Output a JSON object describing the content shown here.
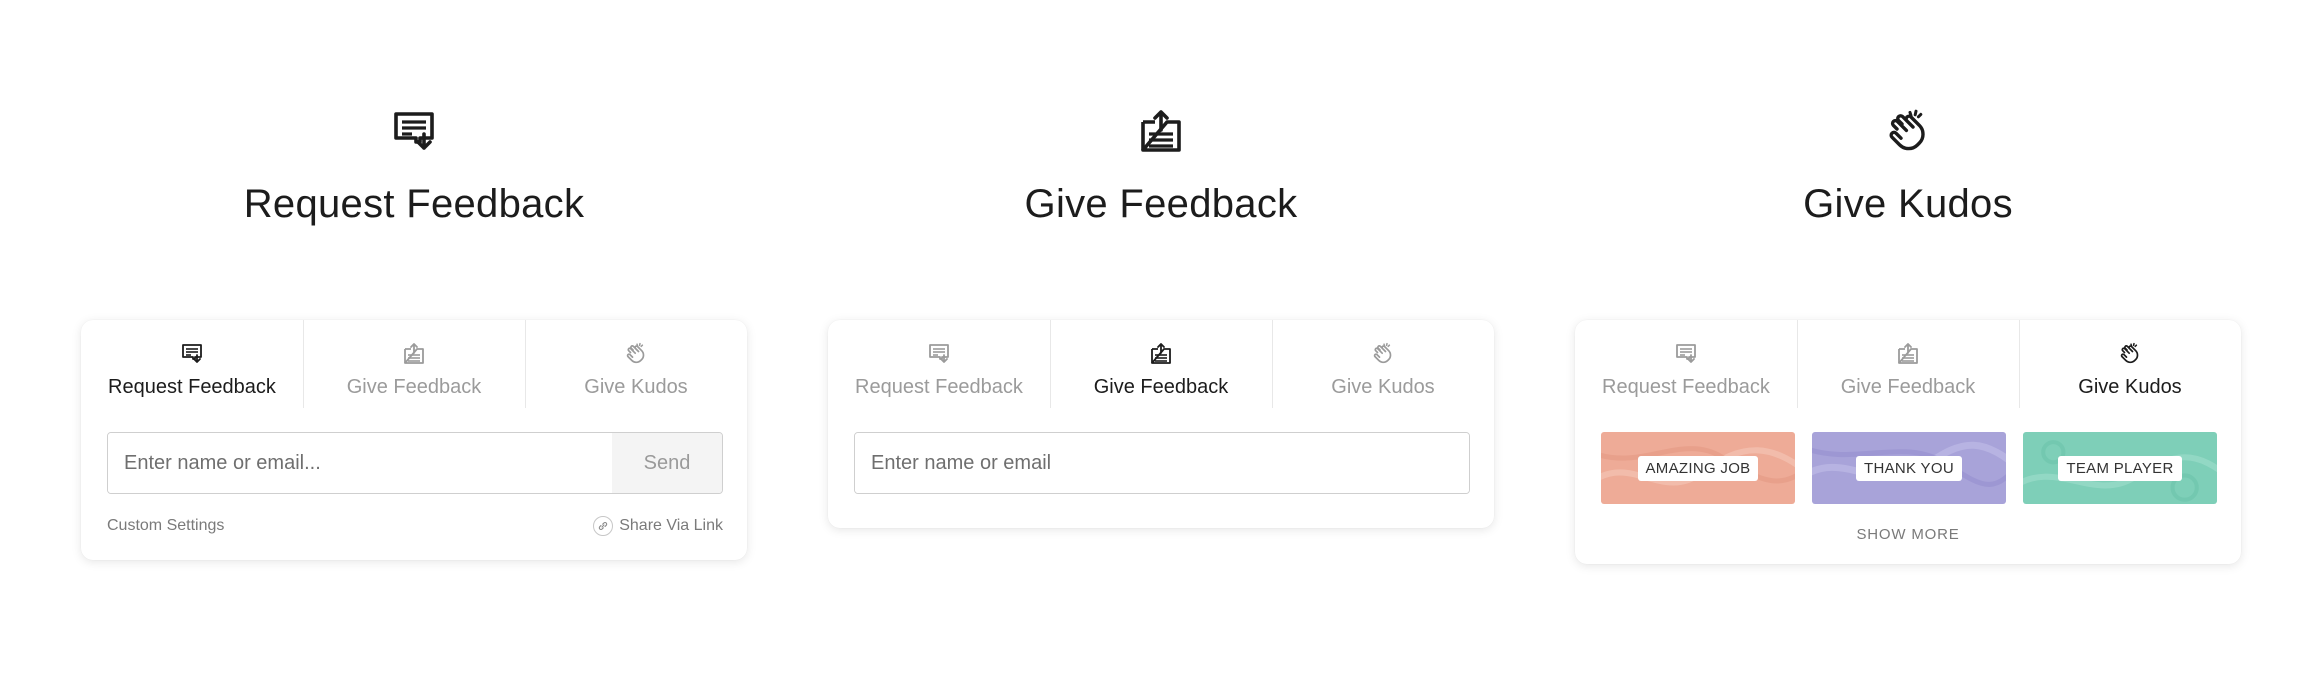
{
  "sections": [
    {
      "icon": "request-feedback-icon",
      "title": "Request Feedback",
      "active_tab": 0
    },
    {
      "icon": "give-feedback-icon",
      "title": "Give Feedback",
      "active_tab": 1
    },
    {
      "icon": "clapping-hands-icon",
      "title": "Give Kudos",
      "active_tab": 2
    }
  ],
  "tabs": [
    {
      "label": "Request Feedback",
      "icon": "request-feedback-icon"
    },
    {
      "label": "Give Feedback",
      "icon": "give-feedback-icon"
    },
    {
      "label": "Give Kudos",
      "icon": "clapping-hands-icon"
    }
  ],
  "request_card": {
    "placeholder": "Enter name or email...",
    "value": "",
    "send_label": "Send",
    "custom_settings_label": "Custom Settings",
    "share_link_label": "Share Via Link",
    "share_icon": "link-icon"
  },
  "give_card": {
    "placeholder": "Enter name or email",
    "value": ""
  },
  "kudos_card": {
    "cards": [
      {
        "label": "AMAZING JOB",
        "color": "#eeab97"
      },
      {
        "label": "THANK YOU",
        "color": "#a8a3d9"
      },
      {
        "label": "TEAM PLAYER",
        "color": "#7ecfb8"
      }
    ],
    "show_more_label": "SHOW MORE"
  },
  "colors": {
    "active_text": "#1c1c1c",
    "inactive_text": "#9b9b9b",
    "border": "#cfcfcf"
  }
}
